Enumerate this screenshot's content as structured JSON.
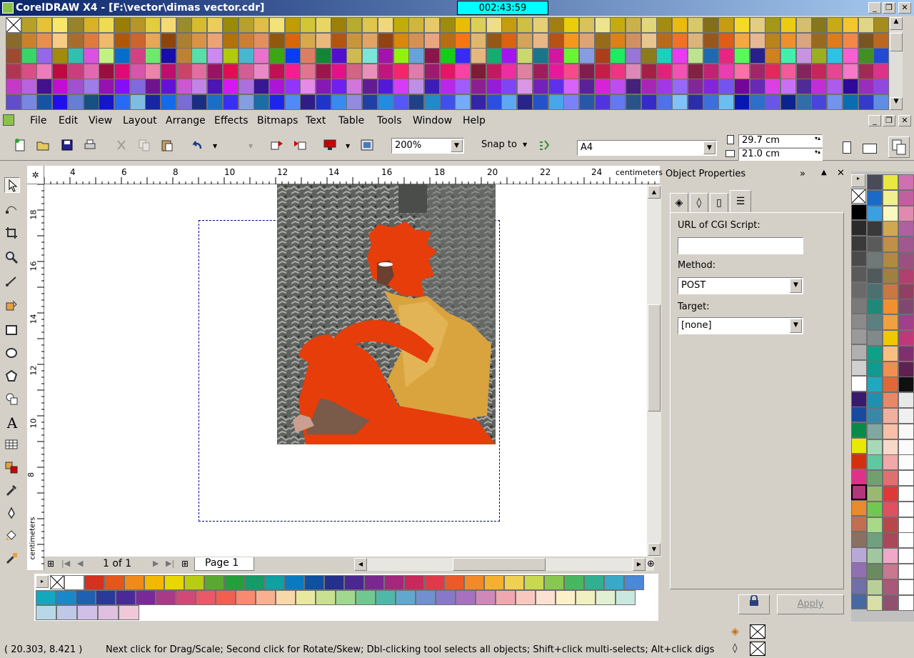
{
  "window": {
    "title": "CorelDRAW X4 - [F:\\vector\\dimas vector.cdr]",
    "timer": "002:43:59"
  },
  "menu": [
    "File",
    "Edit",
    "View",
    "Layout",
    "Arrange",
    "Effects",
    "Bitmaps",
    "Text",
    "Table",
    "Tools",
    "Window",
    "Help"
  ],
  "toolbar": {
    "zoom": "200%",
    "snap_to": "Snap to",
    "page_size": "A4",
    "width": "29.7 cm",
    "height": "21.0 cm"
  },
  "ruler": {
    "h_ticks": [
      "4",
      "6",
      "8",
      "10",
      "12",
      "14",
      "16",
      "18",
      "20",
      "22",
      "24"
    ],
    "h_unit": "centimeters",
    "v_ticks": [
      "18",
      "16",
      "14",
      "12",
      "10",
      "8"
    ],
    "v_unit": "centimeters"
  },
  "page_nav": {
    "counter": "1 of 1",
    "tab": "Page 1"
  },
  "docker": {
    "title": "Object Properties",
    "url_label": "URL of CGI Script:",
    "url_value": "",
    "method_label": "Method:",
    "method_value": "POST",
    "target_label": "Target:",
    "target_value": "[none]",
    "apply": "Apply"
  },
  "status": {
    "coords": "( 20.303, 8.421 )",
    "hint": "Next click for Drag/Scale; Second click for Rotate/Skew; Dbl-clicking tool selects all objects; Shift+click multi-selects; Alt+click digs"
  },
  "colors": {
    "accent": "#0a246a",
    "timer": "#00ffff",
    "fill": "#e63d0a"
  }
}
